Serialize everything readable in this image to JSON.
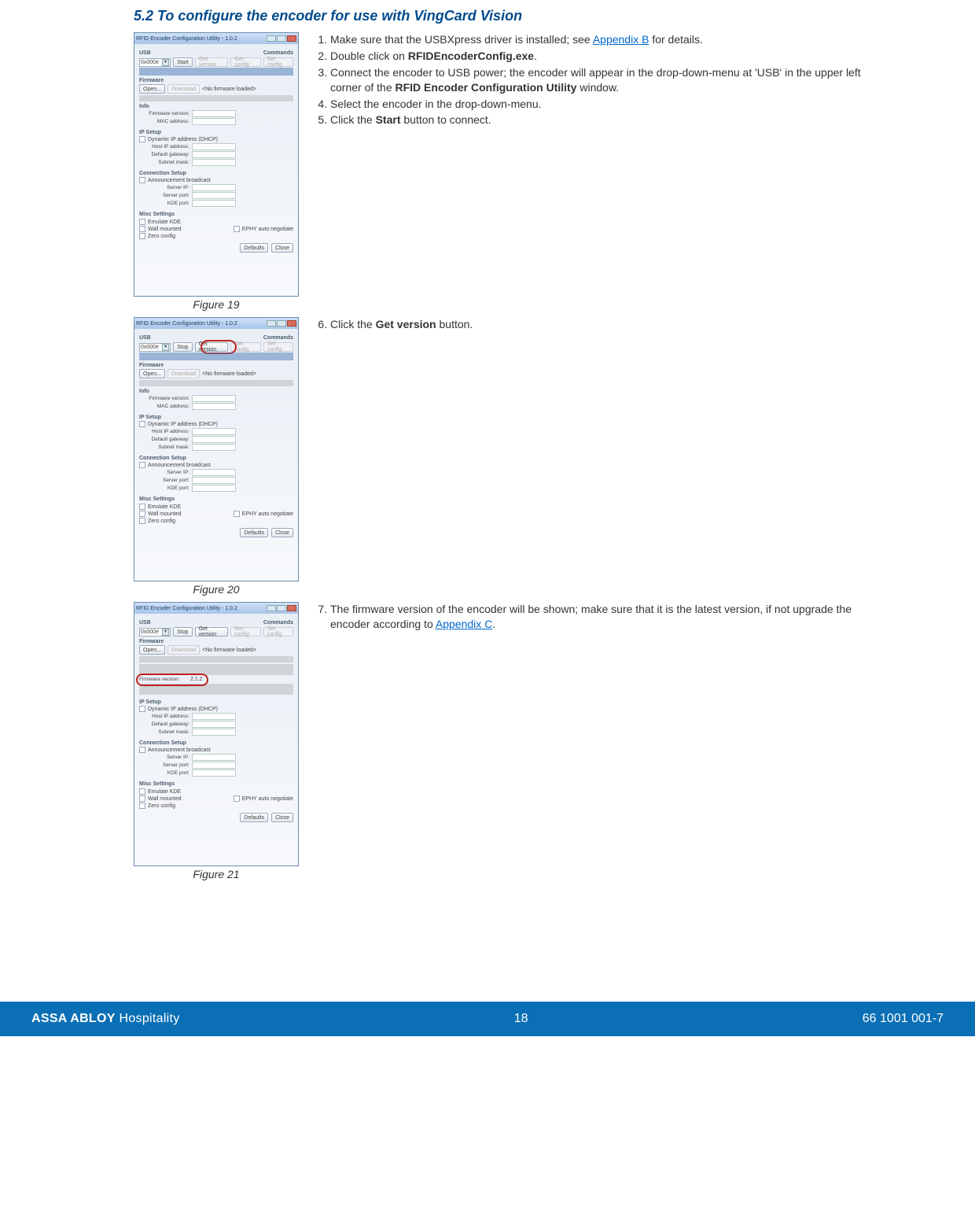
{
  "section_title": "5.2 To configure the encoder for use with VingCard Vision",
  "win": {
    "title": "RFID Encoder Configuration Utility - 1.0.2",
    "usb_label": "USB",
    "cmds_label": "Commands",
    "dropdown_value": "0x000e",
    "start": "Start",
    "stop": "Stop",
    "get_version": "Get version",
    "get_config": "Get config",
    "set_config": "Set config",
    "firmware_label": "Firmware",
    "open": "Open...",
    "download": "Download",
    "no_fw": "<No firmware loaded>",
    "info_label": "Info",
    "fw_version": "Firmware version:",
    "fw_value_shown": "2.1.2",
    "mac": "MAC address:",
    "ip_setup": "IP Setup",
    "dhcp": "Dynamic IP address (DHCP)",
    "host_ip": "Host IP address:",
    "gateway": "Default gateway:",
    "subnet": "Subnet mask:",
    "conn_setup": "Connection Setup",
    "ann_bcast": "Announcement broadcast",
    "server_ip": "Server IP:",
    "server_port": "Server port:",
    "kde_port": "KDE port:",
    "misc": "Misc Settings",
    "emulate_kde": "Emulate KDE",
    "wall_mounted": "Wall mounted",
    "zero_config": "Zero config",
    "phy_auto": "EPHY auto negotiate",
    "defaults": "Defaults",
    "close": "Close"
  },
  "steps_a": {
    "s1a": "Make sure that the USBXpress driver is installed; see ",
    "s1_link": "Appendix B",
    "s1b": " for details.",
    "s2a": "Double click on ",
    "s2_bold": "RFIDEncoderConfig.exe",
    "s2b": ".",
    "s3a": "Connect the encoder to USB power; the encoder will appear in the drop-down-menu at 'USB' in the upper left corner of the ",
    "s3_bold": "RFID Encoder Configuration Utility",
    "s3b": " window.",
    "s4": "Select the encoder in the drop-down-menu.",
    "s5a": "Click the ",
    "s5_bold": "Start",
    "s5b": " button to connect."
  },
  "steps_b": {
    "s6a": "Click the ",
    "s6_bold": "Get version",
    "s6b": " button."
  },
  "steps_c": {
    "s7a": "The firmware version of the encoder will be shown; make sure that it is the latest version, if not upgrade the encoder according to ",
    "s7_link": "Appendix C",
    "s7b": "."
  },
  "captions": {
    "f19": "Figure 19",
    "f20": "Figure 20",
    "f21": "Figure 21"
  },
  "footer": {
    "brand_a": "ASSA ABLOY",
    "brand_b": " Hospitality",
    "page": "18",
    "docnum": "66 1001 001-7"
  }
}
